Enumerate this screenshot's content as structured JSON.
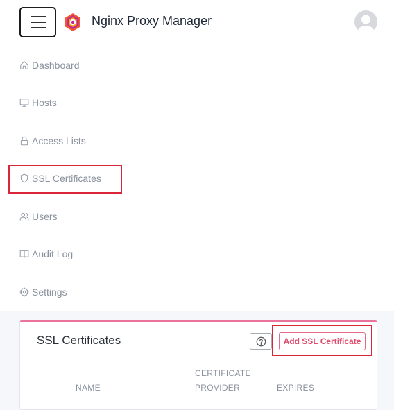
{
  "header": {
    "brand": "Nginx Proxy Manager",
    "menu_icon": "hamburger-icon",
    "logo_icon": "nginx-proxy-manager-logo",
    "avatar_icon": "user-avatar-icon"
  },
  "nav": {
    "items": [
      {
        "label": "Dashboard",
        "icon": "home-icon"
      },
      {
        "label": "Hosts",
        "icon": "monitor-icon"
      },
      {
        "label": "Access Lists",
        "icon": "lock-icon"
      },
      {
        "label": "SSL Certificates",
        "icon": "shield-icon",
        "highlighted": true
      },
      {
        "label": "Users",
        "icon": "users-icon"
      },
      {
        "label": "Audit Log",
        "icon": "book-icon"
      },
      {
        "label": "Settings",
        "icon": "gear-icon"
      }
    ]
  },
  "card": {
    "title": "SSL Certificates",
    "help_icon": "help-circle-icon",
    "add_label": "Add SSL Certificate",
    "columns": {
      "name": "NAME",
      "provider_line1": "CERTIFICATE",
      "provider_line2": "PROVIDER",
      "expires": "EXPIRES"
    }
  },
  "colors": {
    "accent": "#e04a6c",
    "highlight_box": "#d9263a",
    "nav_text": "#8a929e"
  }
}
